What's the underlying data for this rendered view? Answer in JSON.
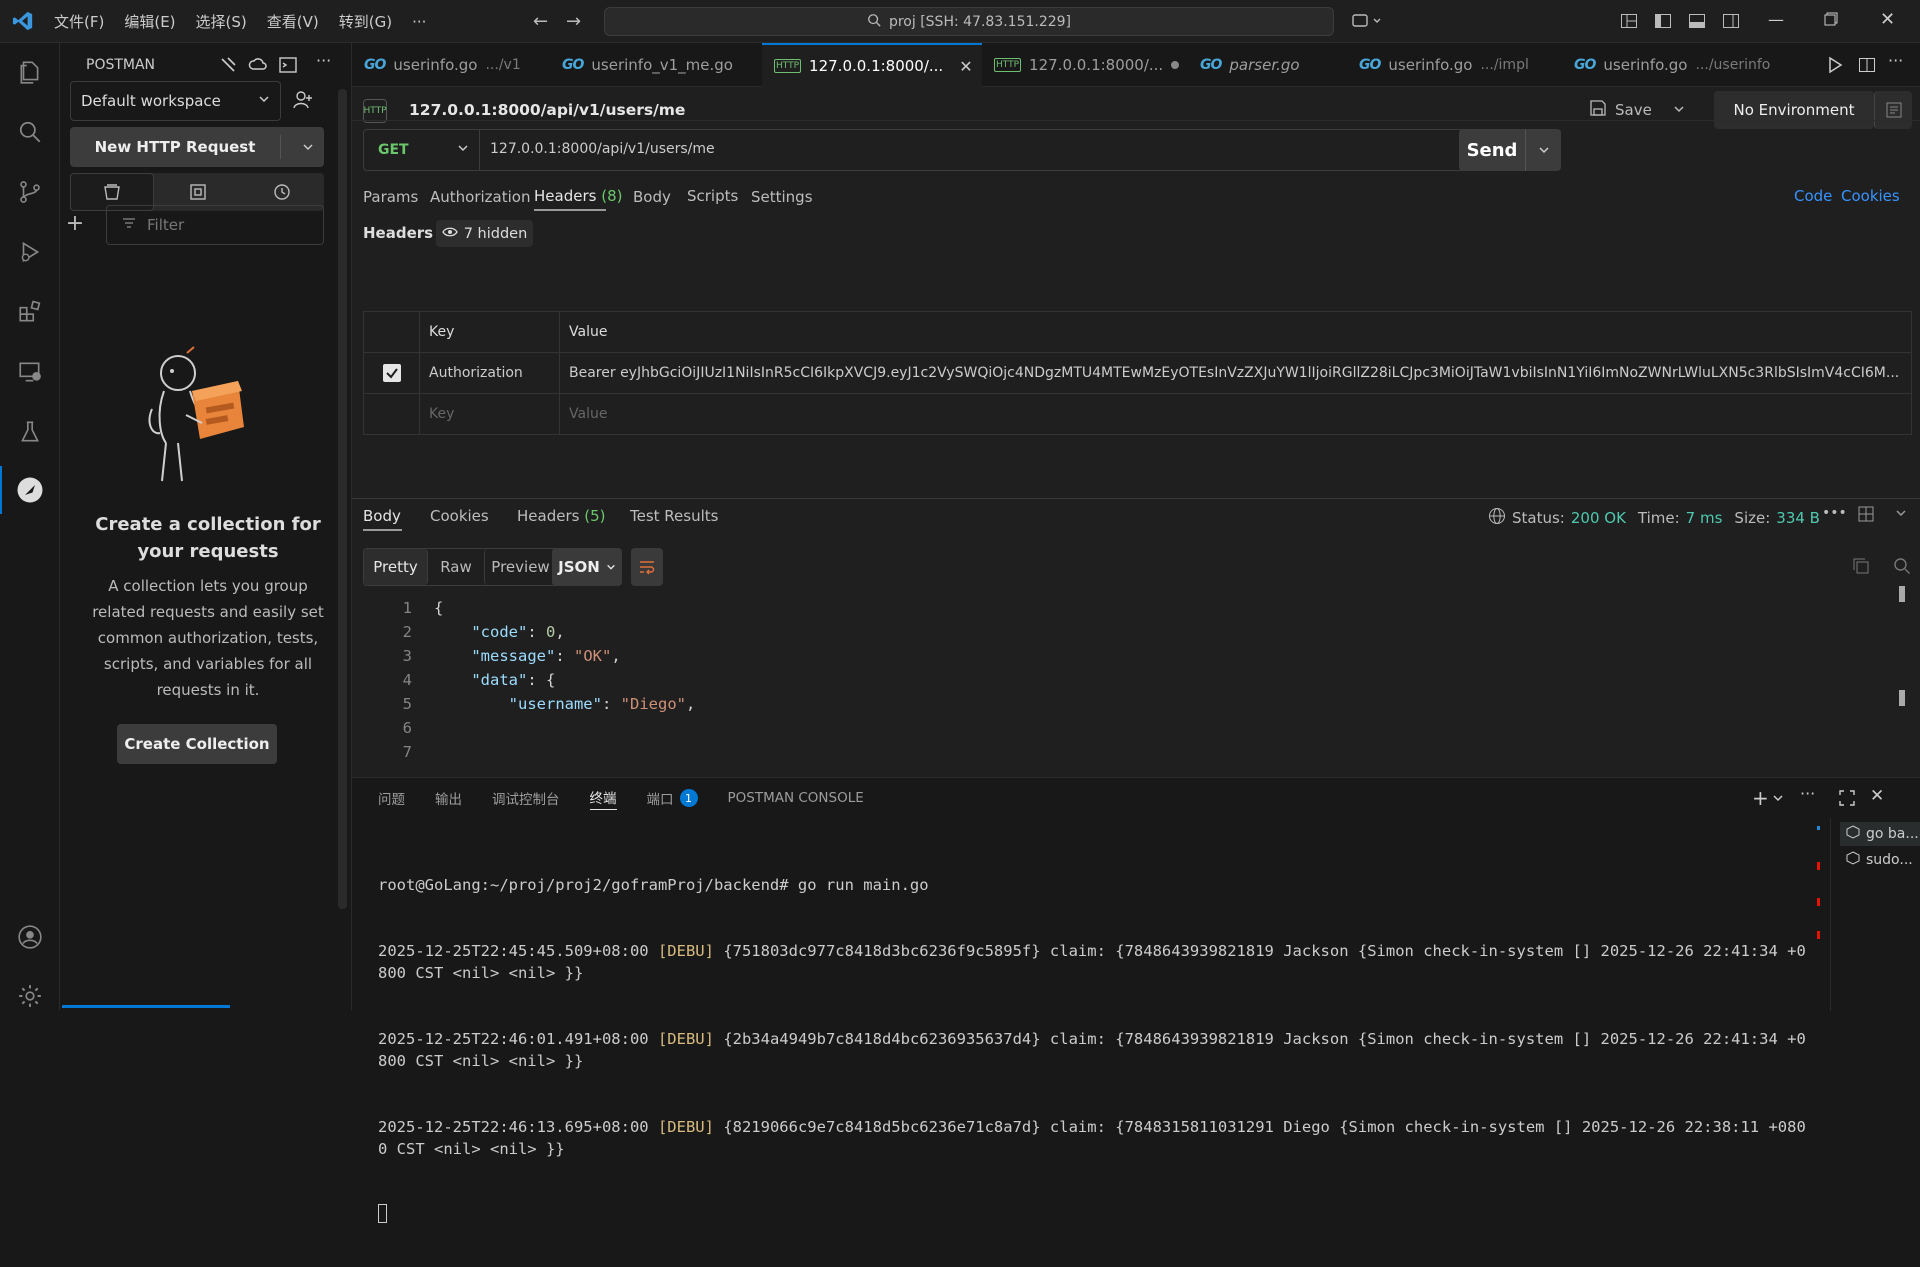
{
  "menu": [
    "文件(F)",
    "编辑(E)",
    "选择(S)",
    "查看(V)",
    "转到(G)",
    "···"
  ],
  "search": "proj [SSH: 47.83.151.229]",
  "sidebar": {
    "title": "POSTMAN",
    "workspace": "Default workspace",
    "new_request": "New HTTP Request",
    "filter_placeholder": "Filter",
    "empty_title": "Create a collection for your requests",
    "empty_desc": "A collection lets you group related requests and easily set common authorization, tests, scripts, and variables for all requests in it.",
    "create_btn": "Create Collection"
  },
  "tabs": [
    {
      "icon": "GO",
      "label": "userinfo.go",
      "sub": ".../v1"
    },
    {
      "icon": "GO",
      "label": "userinfo_v1_me.go",
      "sub": ""
    },
    {
      "icon": "HTTP",
      "label": "127.0.0.1:8000/...",
      "sub": ""
    },
    {
      "icon": "HTTP",
      "label": "127.0.0.1:8000/...",
      "sub": ""
    },
    {
      "icon": "GO",
      "label": "parser.go",
      "sub": ""
    },
    {
      "icon": "GO",
      "label": "userinfo.go",
      "sub": ".../impl"
    },
    {
      "icon": "GO",
      "label": "userinfo.go",
      "sub": ".../userinfo"
    }
  ],
  "request": {
    "title": "127.0.0.1:8000/api/v1/users/me",
    "save": "Save",
    "environment": "No Environment",
    "method": "GET",
    "url": "127.0.0.1:8000/api/v1/users/me",
    "send": "Send",
    "tabs": [
      "Params",
      "Authorization",
      "Headers",
      "Body",
      "Scripts",
      "Settings"
    ],
    "headers_count": "(8)",
    "code_link": "Code",
    "cookies_link": "Cookies",
    "headers_label": "Headers",
    "hidden": "7 hidden",
    "col_key": "Key",
    "col_value": "Value",
    "row_key": "Authorization",
    "row_value": "Bearer eyJhbGciOiJIUzI1NiIsInR5cCI6IkpXVCJ9.eyJ1c2VySWQiOjc4NDgzMTU4MTEwMzEyOTEsInVzZXJuYW1lIjoiRGllZ28iLCJpc3MiOiJTaW1vbiIsInN1YiI6ImNoZWNrLWluLXN5c3RlbSIsImV4cCI6M...",
    "key_placeholder": "Key",
    "value_placeholder": "Value"
  },
  "response": {
    "tabs": [
      "Body",
      "Cookies",
      "Headers",
      "Test Results"
    ],
    "headers_count": "(5)",
    "status_label": "Status:",
    "status": "200 OK",
    "time_label": "Time:",
    "time": "7 ms",
    "size_label": "Size:",
    "size": "334 B",
    "views": [
      "Pretty",
      "Raw",
      "Preview"
    ],
    "format": "JSON",
    "lines": [
      "1",
      "2",
      "3",
      "4",
      "5",
      "6",
      "7"
    ]
  },
  "panel": {
    "tabs": [
      "问题",
      "输出",
      "调试控制台",
      "终端",
      "端口",
      "POSTMAN CONSOLE"
    ],
    "ports_badge": "1",
    "terminals": [
      "go ba...",
      "sudo..."
    ],
    "prompt": "root@GoLang:~/proj/proj2/goframProj/backend# go run main.go",
    "logs": [
      {
        "ts": "2025-12-25T22:45:45.509+08:00",
        "level": "[DEBU]",
        "msg": "{751803dc977c8418d3bc6236f9c5895f} claim: {7848643939821819 Jackson {Simon check-in-system [] 2025-12-26 22:41:34 +0800 CST <nil> <nil> }}"
      },
      {
        "ts": "2025-12-25T22:46:01.491+08:00",
        "level": "[DEBU]",
        "msg": "{2b34a4949b7c8418d4bc6236935637d4} claim: {7848643939821819 Jackson {Simon check-in-system [] 2025-12-26 22:41:34 +0800 CST <nil> <nil> }}"
      },
      {
        "ts": "2025-12-25T22:46:13.695+08:00",
        "level": "[DEBU]",
        "msg": "{8219066c9e7c8418d5bc6236e71c8a7d} claim: {7848315811031291 Diego {Simon check-in-system [] 2025-12-26 22:38:11 +0800 CST <nil> <nil> }}"
      }
    ]
  },
  "colors": {
    "accent": "#0078d4",
    "status_green": "#4ec9b0",
    "send_bg": "#3c3c3c"
  }
}
